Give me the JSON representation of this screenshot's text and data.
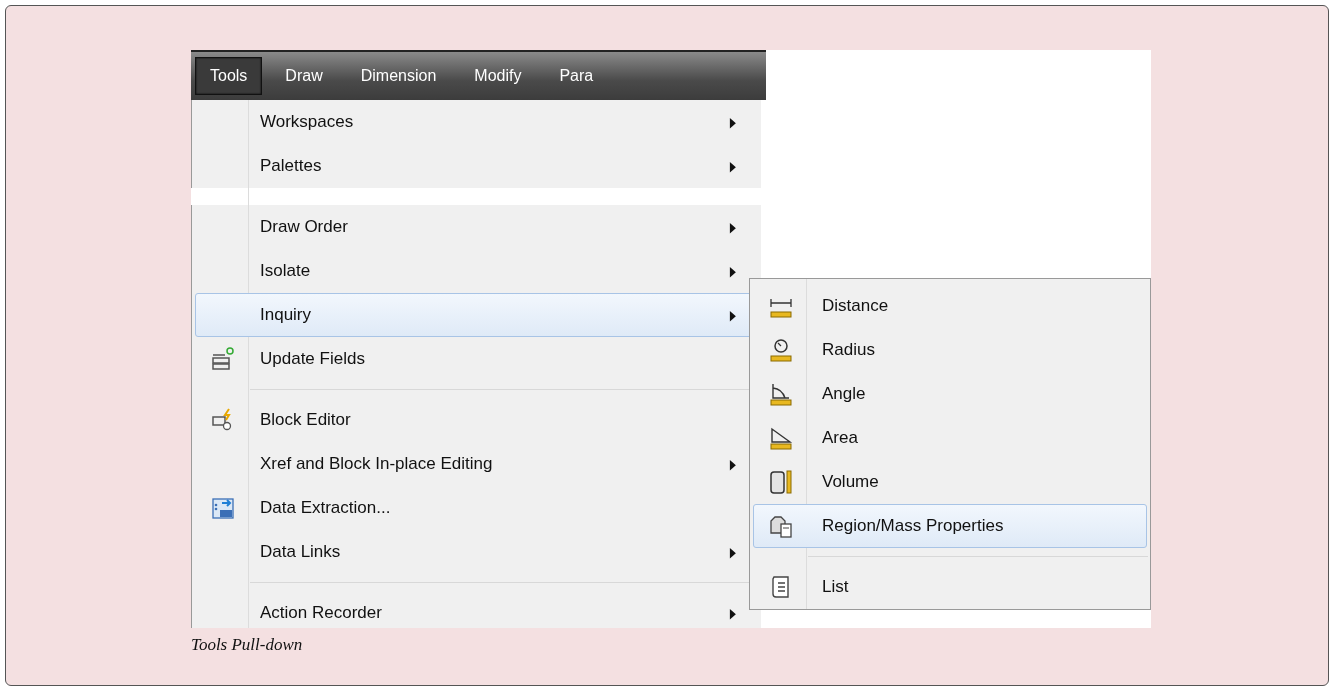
{
  "menu_bar": [
    {
      "label": "Tools",
      "selected": true
    },
    {
      "label": "Draw",
      "selected": false
    },
    {
      "label": "Dimension",
      "selected": false
    },
    {
      "label": "Modify",
      "selected": false
    },
    {
      "label": "Para",
      "selected": false
    }
  ],
  "tools_menu": [
    {
      "kind": "command",
      "label": "Workspaces",
      "submenu": true,
      "selected": false
    },
    {
      "kind": "command",
      "label": "Palettes",
      "submenu": true,
      "selected": false
    },
    {
      "kind": "gap"
    },
    {
      "kind": "command",
      "label": "Draw Order",
      "submenu": true,
      "selected": false
    },
    {
      "kind": "command",
      "label": "Isolate",
      "submenu": true,
      "selected": false
    },
    {
      "kind": "command",
      "label": "Inquiry",
      "submenu": true,
      "selected": true
    },
    {
      "kind": "command",
      "label": "Update Fields",
      "submenu": false,
      "selected": false
    },
    {
      "kind": "separator"
    },
    {
      "kind": "command",
      "label": "Block Editor",
      "submenu": false,
      "selected": false
    },
    {
      "kind": "command",
      "label": "Xref and Block In-place Editing",
      "submenu": true,
      "selected": false
    },
    {
      "kind": "command",
      "label": "Data Extraction...",
      "submenu": false,
      "selected": false
    },
    {
      "kind": "command",
      "label": "Data Links",
      "submenu": true,
      "selected": false
    },
    {
      "kind": "separator"
    },
    {
      "kind": "command",
      "label": "Action Recorder",
      "submenu": true,
      "selected": false
    }
  ],
  "inquiry_submenu": [
    {
      "kind": "command",
      "label": "Distance",
      "selected": false
    },
    {
      "kind": "command",
      "label": "Radius",
      "selected": false
    },
    {
      "kind": "command",
      "label": "Angle",
      "selected": false
    },
    {
      "kind": "command",
      "label": "Area",
      "selected": false
    },
    {
      "kind": "command",
      "label": "Volume",
      "selected": false
    },
    {
      "kind": "command",
      "label": "Region/Mass Properties",
      "selected": true
    },
    {
      "kind": "separator"
    },
    {
      "kind": "command",
      "label": "List",
      "selected": false
    }
  ],
  "caption": "Tools Pull-down"
}
